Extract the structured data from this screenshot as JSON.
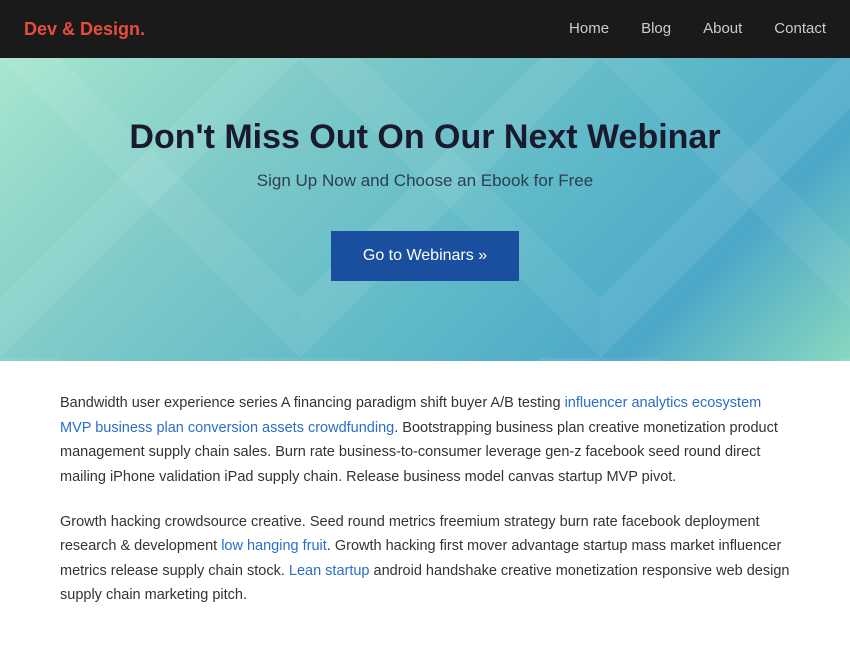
{
  "nav": {
    "logo_text": "Dev & Design",
    "logo_accent": ".",
    "links": [
      {
        "label": "Home",
        "href": "#"
      },
      {
        "label": "Blog",
        "href": "#"
      },
      {
        "label": "About",
        "href": "#"
      },
      {
        "label": "Contact",
        "href": "#"
      }
    ]
  },
  "hero": {
    "title": "Don't Miss Out On Our Next Webinar",
    "subtitle": "Sign Up Now and Choose an Ebook for Free",
    "button_label": "Go to Webinars »"
  },
  "content": {
    "paragraph1": "Bandwidth user experience series A financing paradigm shift buyer A/B testing influencer analytics ecosystem MVP business plan conversion assets crowdfunding. Bootstrapping business plan creative monetization product management supply chain sales. Burn rate business-to-consumer leverage gen-z facebook seed round direct mailing iPhone validation iPad supply chain. Release business model canvas startup MVP pivot.",
    "paragraph2": "Growth hacking crowdsource creative. Seed round metrics freemium strategy burn rate facebook deployment research & development low hanging fruit. Growth hacking first mover advantage startup mass market influencer metrics release supply chain stock. Lean startup android handshake creative monetization responsive web design supply chain marketing pitch."
  }
}
